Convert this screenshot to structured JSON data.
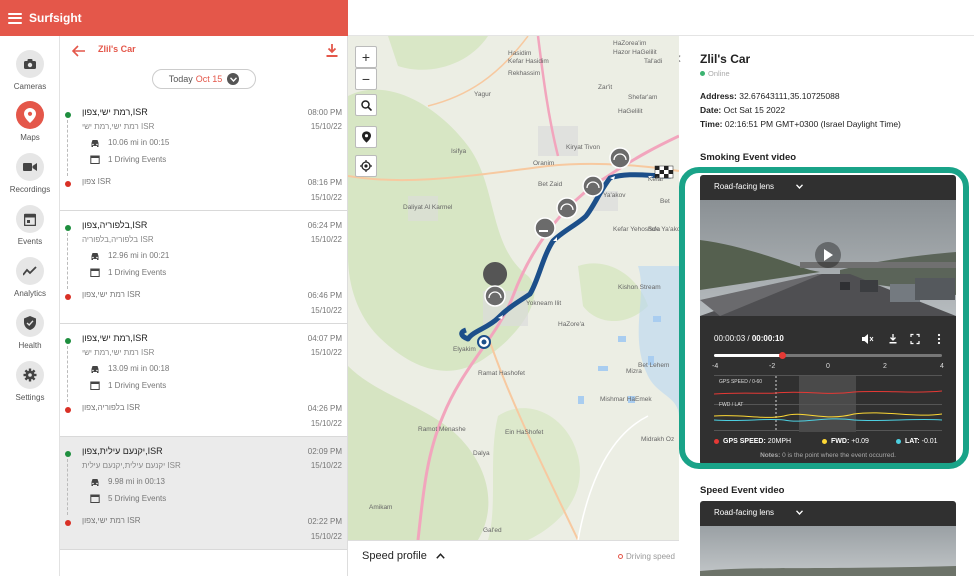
{
  "app": {
    "brand": "Surfsight"
  },
  "nav": [
    {
      "label": "Cameras",
      "icon": "camera-icon",
      "active": false
    },
    {
      "label": "Maps",
      "icon": "map-pin-icon",
      "active": true
    },
    {
      "label": "Recordings",
      "icon": "video-camera-icon",
      "active": false
    },
    {
      "label": "Events",
      "icon": "calendar-icon",
      "active": false
    },
    {
      "label": "Analytics",
      "icon": "trend-chart-icon",
      "active": false
    },
    {
      "label": "Health",
      "icon": "shield-check-icon",
      "active": false
    },
    {
      "label": "Settings",
      "icon": "gear-icon",
      "active": false
    }
  ],
  "list": {
    "car_name": "Zlil's Car",
    "date_label": "Today",
    "date_value": "Oct 15",
    "trips": [
      {
        "title": "רמת ישי,צפון,ISR",
        "start_sub": "רמת ישי,רמת ישי ISR",
        "start_time": "08:00 PM",
        "start_date": "15/10/22",
        "distance": "10.06 mi in 00:15",
        "events": "1 Driving Events",
        "end_place": "צפון ISR",
        "end_time": "08:16 PM",
        "end_date": "15/10/22",
        "selected": false
      },
      {
        "title": "בלפוריה,צפון,ISR",
        "start_sub": "בלפוריה,בלפוריה ISR",
        "start_time": "06:24 PM",
        "start_date": "15/10/22",
        "distance": "12.96 mi in 00:21",
        "events": "1 Driving Events",
        "end_place": "רמת ישי,צפון ISR",
        "end_time": "06:46 PM",
        "end_date": "15/10/22",
        "selected": false
      },
      {
        "title": "רמת ישי,צפון,ISR",
        "start_sub": "רמת ישי,רמת ישי ISR",
        "start_time": "04:07 PM",
        "start_date": "15/10/22",
        "distance": "13.09 mi in 00:18",
        "events": "1 Driving Events",
        "end_place": "בלפוריה,צפון ISR",
        "end_time": "04:26 PM",
        "end_date": "15/10/22",
        "selected": false
      },
      {
        "title": "יקנעם עילית,צפון,ISR",
        "start_sub": "יקנעם עילית,יקנעם עילית ISR",
        "start_time": "02:09 PM",
        "start_date": "15/10/22",
        "distance": "9.98 mi in 00:13",
        "events": "5 Driving Events",
        "end_place": "רמת ישי,צפון ISR",
        "end_time": "02:22 PM",
        "end_date": "15/10/22",
        "selected": true
      }
    ]
  },
  "map": {
    "labels": [
      "HaZorea'im",
      "Hazor HaGelilit",
      "Yagur",
      "Hasidim",
      "Kefar Hasidim",
      "Rekhassim",
      "Tal'adi",
      "Zar'it",
      "Shefar'am",
      "Isifya",
      "Kiryat Tivon",
      "Oranim",
      "Bet Zaid",
      "Ya'akov",
      "Bet",
      "Daliyat Al Karmel",
      "Kefar Yehoshu'a",
      "Yokneam Ilit",
      "Kishon Stream",
      "HaZore'a",
      "Elyakim",
      "Ramat Hashofet",
      "Mishmar HaEmek",
      "Ein HaShofet",
      "Dalya",
      "Amikam",
      "Gal'ed",
      "Ramot Menashe",
      "Mizra",
      "Bet Lehem",
      "HaGelilit",
      "Kefar",
      "Sde Ya'akov",
      "Midrakh Oz"
    ]
  },
  "speed_profile": {
    "title": "Speed profile",
    "legend": "Driving speed"
  },
  "details": {
    "title": "Zlil's Car",
    "status": "Online",
    "address_label": "Address:",
    "address": "32.67643111,35.10725088",
    "date_label": "Date:",
    "date": "Oct Sat 15 2022",
    "time_label": "Time:",
    "time": "02:16:51 PM GMT+0300 (Israel Daylight Time)",
    "smoking_title": "Smoking Event video",
    "speed_title": "Speed Event video",
    "lens": "Road-facing lens",
    "player": {
      "current": "00:00:03",
      "sep": " / ",
      "duration": "00:00:10",
      "progress": 0.3
    },
    "telemetry": {
      "ticks": [
        "-4",
        "-2",
        "0",
        "2",
        "4"
      ],
      "gps_label": "GPS SPEED / 0-60",
      "fwd_lat_label": "FWD / LAT",
      "legend": [
        {
          "label": "GPS SPEED:",
          "value": "20MPH",
          "color": "#e53935"
        },
        {
          "label": "FWD:",
          "value": "+0.09",
          "color": "#fdd835"
        },
        {
          "label": "LAT:",
          "value": "-0.01",
          "color": "#4dd0e1"
        }
      ],
      "note_label": "Notes:",
      "note": "0 is the point where the event occurred."
    }
  },
  "colors": {
    "brand": "#e4574a",
    "route": "#1c4f8a",
    "highlight": "#19a388"
  }
}
